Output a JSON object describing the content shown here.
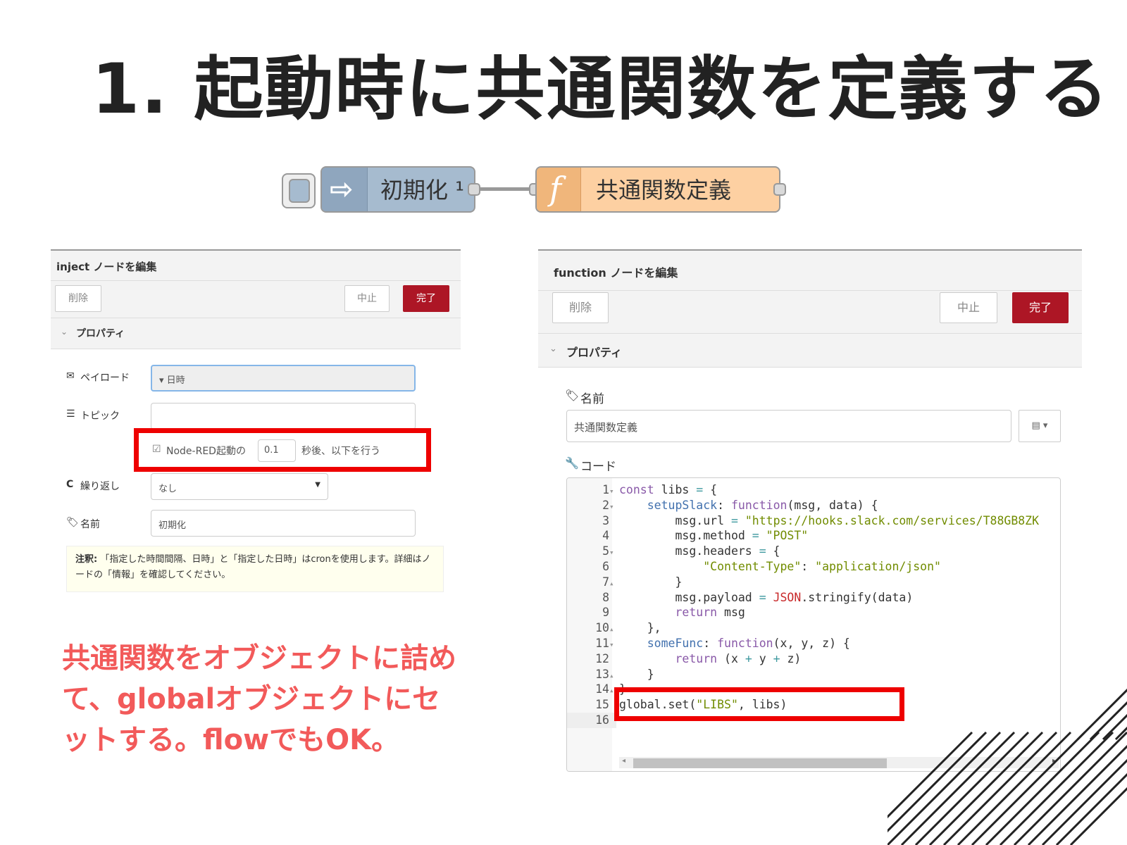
{
  "slide": {
    "title": "1. 起動時に共通関数を定義する",
    "annotation": "共通関数をオブジェクトに詰めて、globalオブジェクトにセットする。flowでもOK。"
  },
  "flow": {
    "inject_node": {
      "label": "初期化 ¹",
      "icon": "arrow-right-icon",
      "color": "#a6bbcf"
    },
    "function_node": {
      "label": "共通関数定義",
      "icon": "function-f-icon",
      "color": "#fdd0a2"
    }
  },
  "inject_dialog": {
    "title": "inject ノードを編集",
    "delete_label": "削除",
    "cancel_label": "中止",
    "done_label": "完了",
    "properties_label": "プロパティ",
    "payload_label": "ペイロード",
    "payload_value": "▾ 日時",
    "topic_label": "トピック",
    "topic_value": "",
    "once_label": "Node-RED起動の",
    "once_delay": "0.1",
    "once_suffix": "秒後、以下を行う",
    "repeat_label": "繰り返し",
    "repeat_value": "なし",
    "name_label": "名前",
    "name_value": "初期化",
    "note_bold": "注釈:",
    "note_text": "「指定した時間間隔、日時」と「指定した日時」はcronを使用します。詳細はノードの「情報」を確認してください。"
  },
  "function_dialog": {
    "title": "function ノードを編集",
    "delete_label": "削除",
    "cancel_label": "中止",
    "done_label": "完了",
    "properties_label": "プロパティ",
    "name_label": "名前",
    "name_value": "共通関数定義",
    "code_label": "コード",
    "code_lines": [
      "const libs = {",
      "    setupSlack: function(msg, data) {",
      "        msg.url = \"https://hooks.slack.com/services/T88GB8ZK",
      "        msg.method = \"POST\"",
      "        msg.headers = {",
      "            \"Content-Type\": \"application/json\"",
      "        }",
      "        msg.payload = JSON.stringify(data)",
      "        return msg",
      "    },",
      "    someFunc: function(x, y, z) {",
      "        return (x + y + z)",
      "    }",
      "}",
      "global.set(\"LIBS\", libs)",
      ""
    ],
    "line_numbers": [
      "1",
      "2",
      "3",
      "4",
      "5",
      "6",
      "7",
      "8",
      "9",
      "10",
      "11",
      "12",
      "13",
      "14",
      "15",
      "16"
    ]
  },
  "colors": {
    "accent_red": "#ad1625",
    "highlight_red": "#ee0000",
    "annotation": "#f25a5a"
  }
}
